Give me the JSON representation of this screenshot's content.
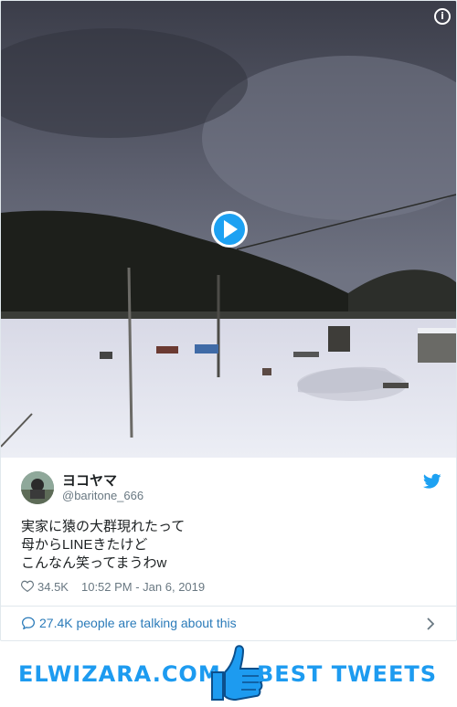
{
  "tweet": {
    "display_name": "ヨコヤマ",
    "handle": "@baritone_666",
    "text_lines": [
      "実家に猿の大群現れたって",
      "母からLINEきたけど",
      "こんなん笑ってまうわw"
    ],
    "likes": "34.5K",
    "timestamp": "10:52 PM - Jan 6, 2019",
    "talking": "27.4K people are talking about this"
  },
  "media": {
    "info_icon": "info-icon",
    "play_icon": "play-button-icon",
    "info_glyph": "i"
  },
  "footer": {
    "left_brand": "ELWIZARA.COM",
    "right_brand": "BEST TWEETS",
    "icon": "thumbs-up-icon"
  },
  "colors": {
    "accent": "#1da1f2",
    "text": "#1c2022",
    "muted": "#697882",
    "link": "#2b7bb9"
  }
}
